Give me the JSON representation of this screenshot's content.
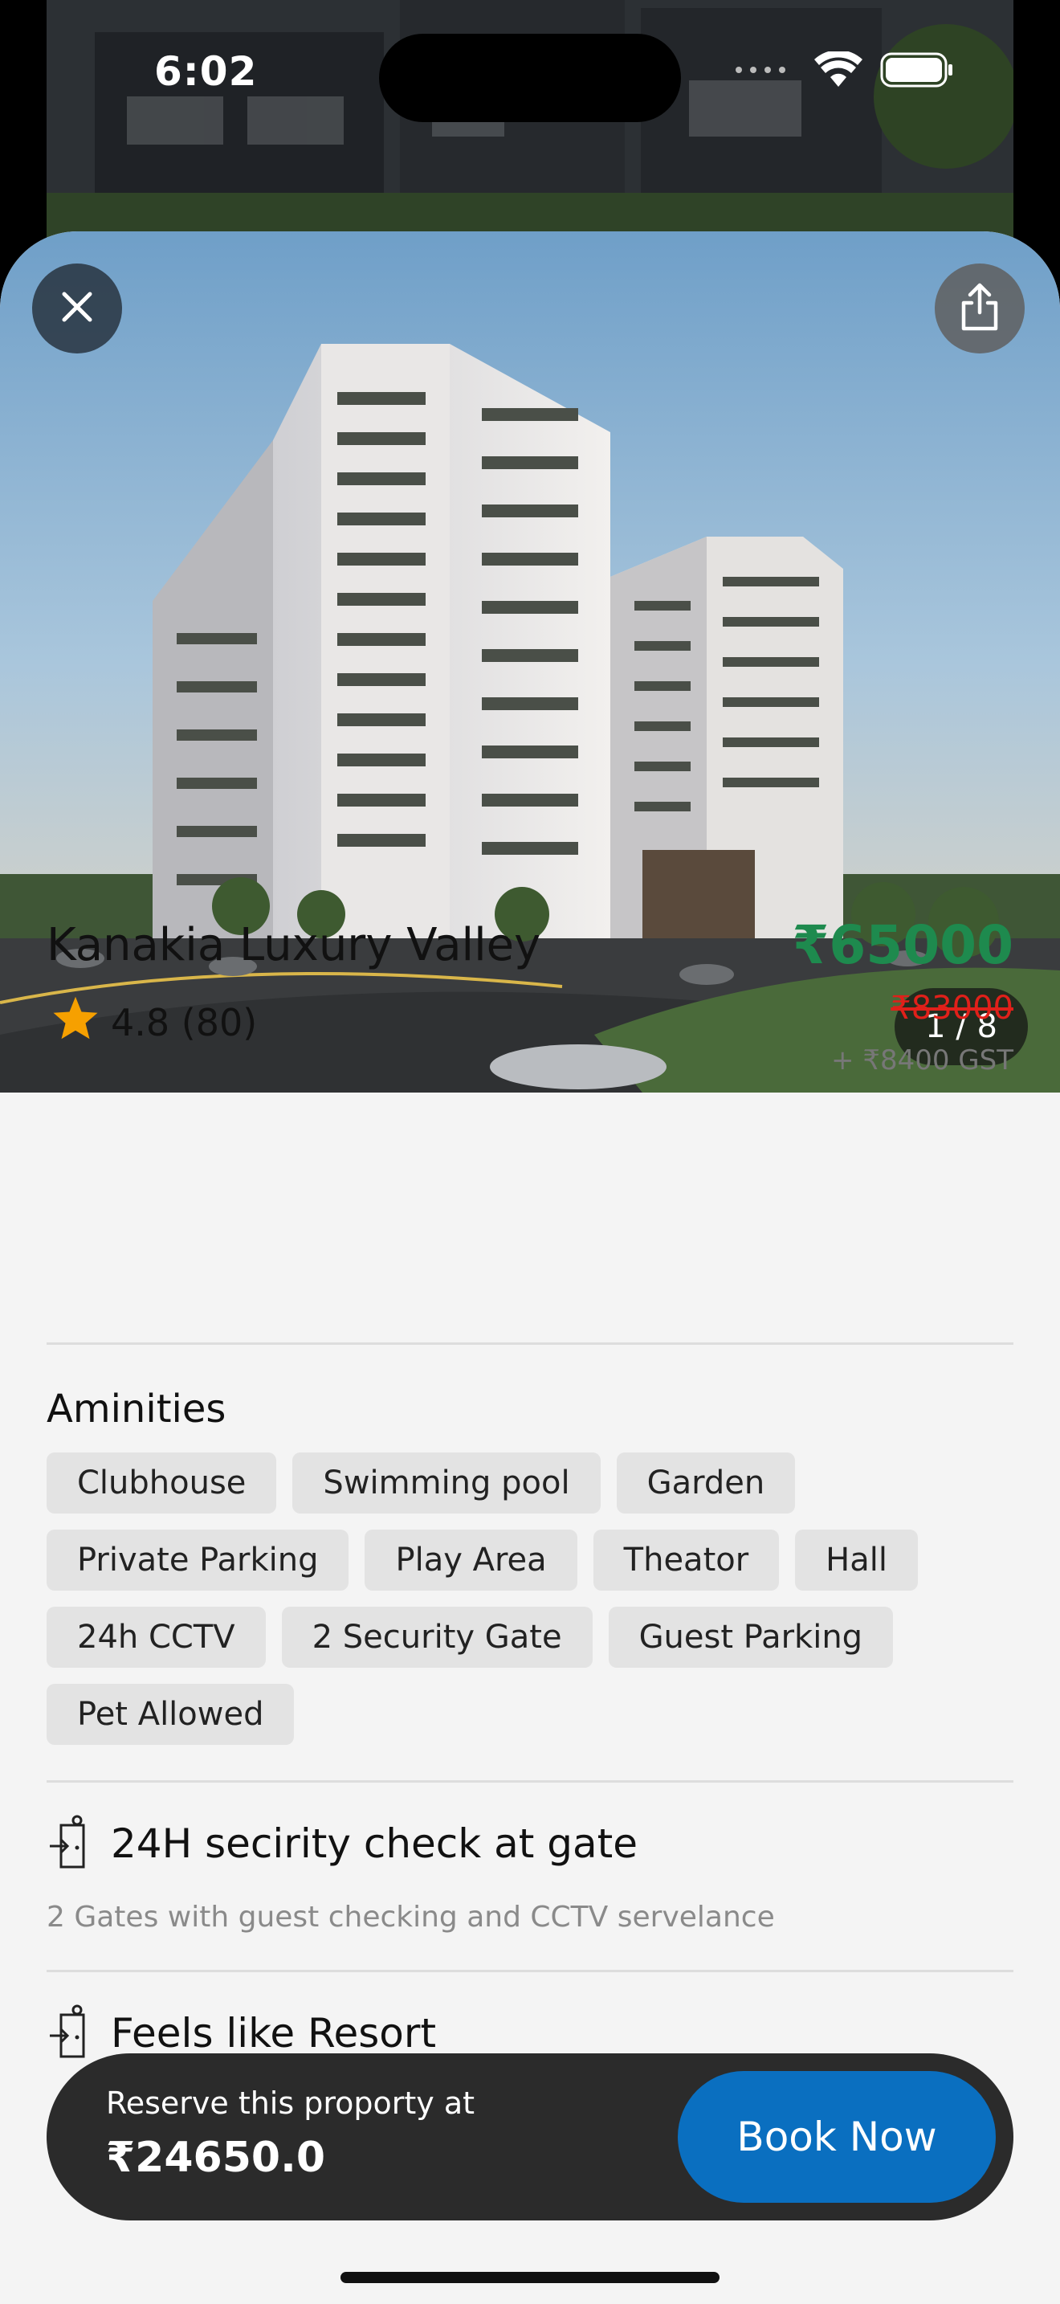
{
  "status_bar": {
    "time": "6:02"
  },
  "gallery": {
    "counter": "1 / 8"
  },
  "property": {
    "name": "Kanakia Luxury Valley",
    "rating": "4.8 (80)",
    "price": "₹65000",
    "original_price": "₹83000",
    "gst": "+ ₹8400 GST"
  },
  "amenities": {
    "heading": "Aminities",
    "items": [
      "Clubhouse",
      "Swimming pool",
      "Garden",
      "Private Parking",
      "Play Area",
      "Theator",
      "Hall",
      "24h CCTV",
      "2 Security Gate",
      "Guest Parking",
      "Pet Allowed"
    ]
  },
  "features": [
    {
      "title": "24H secirity check at gate",
      "description": "2 Gates with guest checking and CCTV servelance"
    },
    {
      "title": "Feels like Resort",
      "description": ""
    }
  ],
  "booking": {
    "label": "Reserve this proporty at",
    "amount": "₹24650.0",
    "button": "Book Now"
  },
  "icons": {
    "close": "close-icon",
    "share": "share-icon",
    "star": "star-icon",
    "gate": "gate-icon"
  },
  "colors": {
    "price_green": "#1e8a4e",
    "strike_red": "#e0201a",
    "book_blue": "#0a6fc0",
    "star_orange": "#f6a000"
  }
}
